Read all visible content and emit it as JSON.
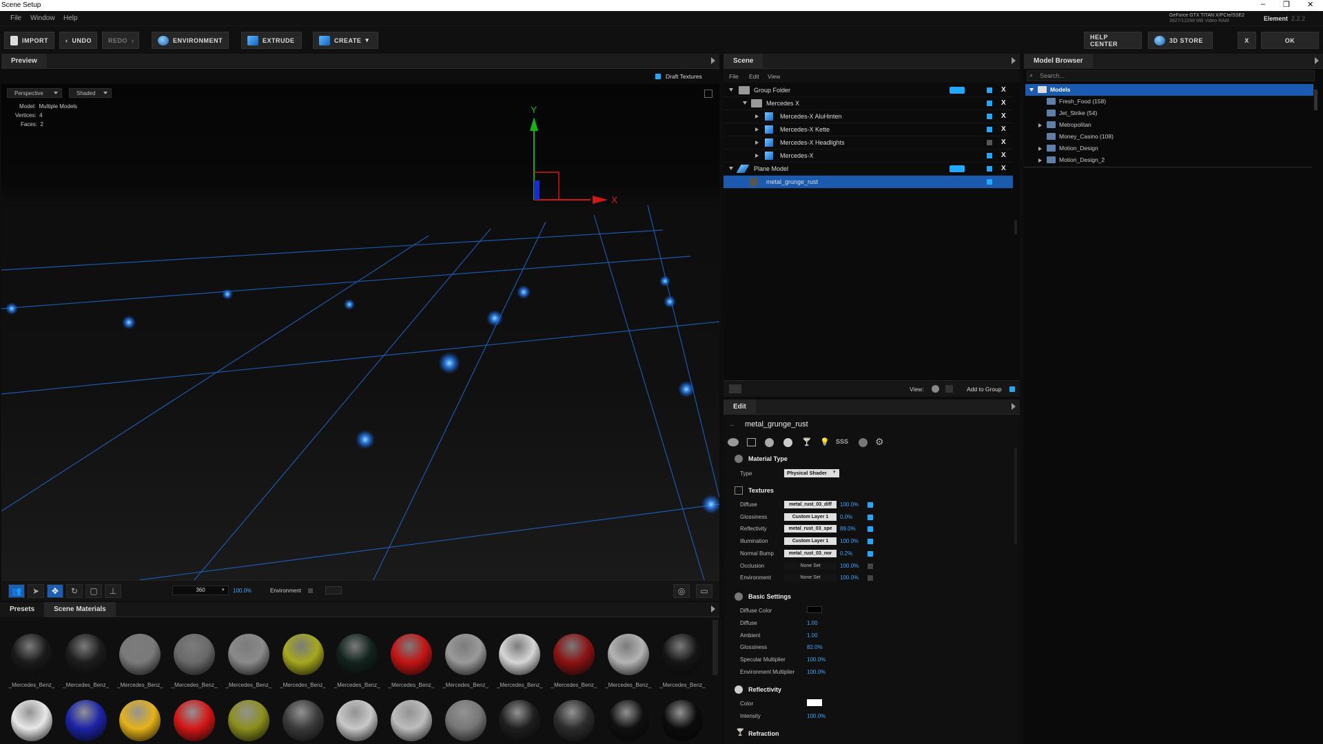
{
  "window": {
    "title": "Scene Setup",
    "minimize": "–",
    "restore": "❐",
    "close": "✕"
  },
  "menu": {
    "file": "File",
    "window": "Window",
    "help": "Help"
  },
  "gpu": {
    "name": "GeForce GTX TITAN X/PCIe/SSE2",
    "ram": "3927/12288 MB Video RAM"
  },
  "element": {
    "name": "Element",
    "version": "2.2.2"
  },
  "toolbar": {
    "import": "IMPORT",
    "undo": "UNDO",
    "redo": "REDO",
    "environment": "ENVIRONMENT",
    "extrude": "EXTRUDE",
    "create": "CREATE",
    "help_center": "HELP CENTER",
    "store": "3D STORE",
    "close": "X",
    "ok": "OK"
  },
  "preview": {
    "title": "Preview",
    "draft_textures": "Draft Textures",
    "camera": "Perspective",
    "shading": "Shaded",
    "model_label": "Model:",
    "model_value": "Multiple Models",
    "vertices_label": "Vertices:",
    "vertices_value": "4",
    "faces_label": "Faces:",
    "faces_value": "2",
    "axis_y": "Y",
    "axis_x": "X",
    "degrees": "360",
    "zoom": "100.0%",
    "environment": "Environment"
  },
  "materials_tabs": {
    "presets": "Presets",
    "scene_materials": "Scene Materials"
  },
  "materials": [
    {
      "label": "_Mercedes_Benz_",
      "color": "#1a1a1a"
    },
    {
      "label": "_Mercedes_Benz_",
      "color": "#1c1c1c"
    },
    {
      "label": "_Mercedes_Benz_",
      "color": "#7a7a7a"
    },
    {
      "label": "_Mercedes_Benz_",
      "color": "#6a6a6a"
    },
    {
      "label": "_Mercedes_Benz_",
      "color": "#8a8a8a"
    },
    {
      "label": "_Mercedes_Benz_",
      "color": "#a6a81e"
    },
    {
      "label": "_Mercedes_Benz_",
      "color": "#12231c"
    },
    {
      "label": "_Mercedes_Benz_",
      "color": "#c41414"
    },
    {
      "label": "_Mercedes_Benz_",
      "color": "#9a9a9a"
    },
    {
      "label": "_Mercedes_Benz_",
      "color": "#d6d6d6"
    },
    {
      "label": "_Mercedes_Benz_",
      "color": "#8a1212"
    },
    {
      "label": "_Mercedes_Benz_",
      "color": "#b4b4b4"
    },
    {
      "label": "_Mercedes_Benz_",
      "color": "#151515"
    }
  ],
  "materials_row2": [
    "#e8e8e8",
    "#1b23a6",
    "#e5b21a",
    "#d41616",
    "#8c8f1c",
    "#3a3a3a",
    "#c8c8c8",
    "#bdbdbd",
    "#777777",
    "#1e1e1e",
    "#2c2c2c",
    "#0f0f0f",
    "#0b0b0b"
  ],
  "scene": {
    "title": "Scene",
    "menu": {
      "file": "File",
      "edit": "Edit",
      "view": "View"
    },
    "rows": [
      {
        "label": "Group Folder"
      },
      {
        "label": "Mercedes X"
      },
      {
        "label": "Mercedes-X AluHinten"
      },
      {
        "label": "Mercedes-X Kette"
      },
      {
        "label": "Mercedes-X Headlights"
      },
      {
        "label": "Mercedes-X"
      },
      {
        "label": "Plane Model"
      },
      {
        "label": "metal_grunge_rust"
      }
    ],
    "view_label": "View:",
    "add_to_group": "Add to Group"
  },
  "edit": {
    "title": "Edit",
    "material_name": "metal_grunge_rust",
    "material_type": {
      "header": "Material Type",
      "type_label": "Type",
      "type_value": "Physical Shader"
    },
    "textures": {
      "header": "Textures",
      "rows": [
        {
          "label": "Diffuse",
          "map": "metal_rust_03_diff",
          "value": "100.0%",
          "on": true
        },
        {
          "label": "Glossiness",
          "map": "Custom Layer 1",
          "value": "0.0%",
          "on": true
        },
        {
          "label": "Reflectivity",
          "map": "metal_rust_03_spe",
          "value": "89.0%",
          "on": true
        },
        {
          "label": "Illumination",
          "map": "Custom Layer 1",
          "value": "100.0%",
          "on": true
        },
        {
          "label": "Normal Bump",
          "map": "metal_rust_03_nor",
          "value": "0.2%",
          "on": true
        },
        {
          "label": "Occlusion",
          "map": "None Set",
          "value": "100.0%",
          "on": false
        },
        {
          "label": "Environment",
          "map": "None Set",
          "value": "100.0%",
          "on": false
        }
      ]
    },
    "basic": {
      "header": "Basic Settings",
      "diffuse_color": "Diffuse Color",
      "rows": [
        {
          "label": "Diffuse",
          "value": "1.00"
        },
        {
          "label": "Ambient",
          "value": "1.00"
        },
        {
          "label": "Glossiness",
          "value": "82.0%"
        },
        {
          "label": "Specular Multiplier",
          "value": "100.0%"
        },
        {
          "label": "Environment Multiplier",
          "value": "100.0%"
        }
      ]
    },
    "reflectivity": {
      "header": "Reflectivity",
      "color": "Color",
      "intensity": "Intensity",
      "intensity_value": "100.0%"
    },
    "refraction": {
      "header": "Refraction"
    },
    "sss": "SSS"
  },
  "browser": {
    "title": "Model Browser",
    "search_placeholder": "Search...",
    "rows": [
      {
        "label": "Models"
      },
      {
        "label": "Fresh_Food (158)"
      },
      {
        "label": "Jet_Strike (54)"
      },
      {
        "label": "Metropolitan"
      },
      {
        "label": "Money_Casino (108)"
      },
      {
        "label": "Motion_Design"
      },
      {
        "label": "Motion_Design_2"
      }
    ]
  }
}
